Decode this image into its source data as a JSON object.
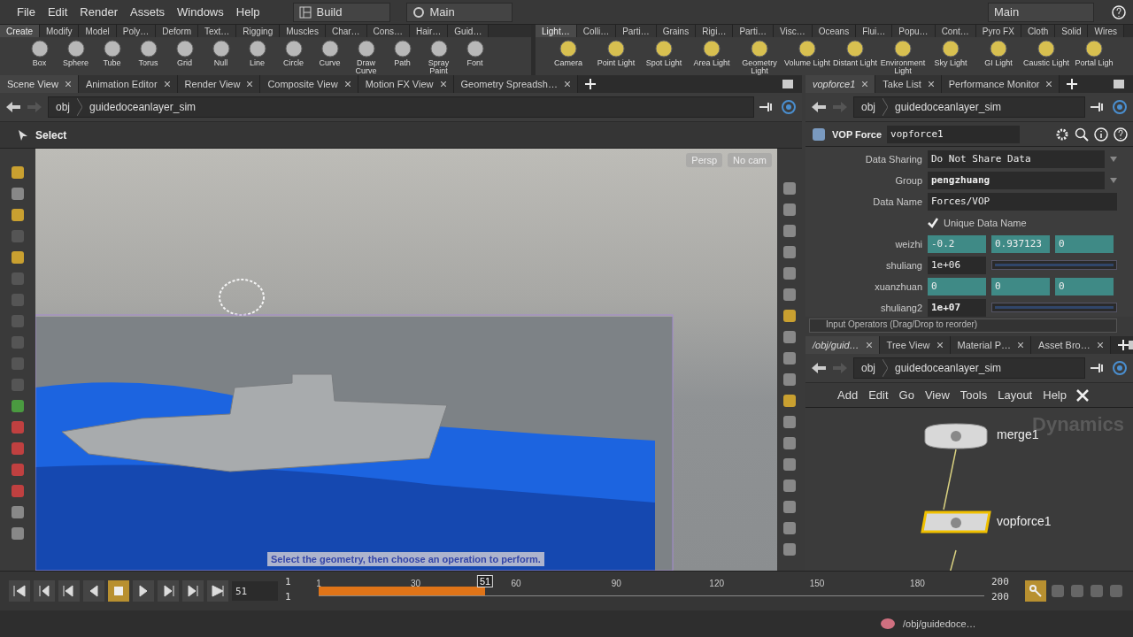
{
  "menubar": {
    "menus": [
      "File",
      "Edit",
      "Render",
      "Assets",
      "Windows",
      "Help"
    ],
    "desktop": "Build",
    "context": "Main",
    "right_context": "Main"
  },
  "shelves": [
    {
      "tabs": [
        {
          "label": "Create",
          "selected": true
        },
        {
          "label": "Modify",
          "selected": false
        },
        {
          "label": "Model",
          "selected": false
        },
        {
          "label": "Poly…",
          "selected": false
        },
        {
          "label": "Deform",
          "selected": false
        },
        {
          "label": "Text…",
          "selected": false
        },
        {
          "label": "Rigging",
          "selected": false
        },
        {
          "label": "Muscles",
          "selected": false
        },
        {
          "label": "Char…",
          "selected": false
        },
        {
          "label": "Cons…",
          "selected": false
        },
        {
          "label": "Hair…",
          "selected": false
        },
        {
          "label": "Guid…",
          "selected": false
        }
      ],
      "tools": [
        "Box",
        "Sphere",
        "Tube",
        "Torus",
        "Grid",
        "Null",
        "Line",
        "Circle",
        "Curve",
        "Draw Curve",
        "Path",
        "Spray Paint",
        "Font"
      ]
    },
    {
      "tabs": [
        {
          "label": "Light…",
          "selected": true
        },
        {
          "label": "Colli…",
          "selected": false
        },
        {
          "label": "Parti…",
          "selected": false
        },
        {
          "label": "Grains",
          "selected": false
        },
        {
          "label": "Rigi…",
          "selected": false
        },
        {
          "label": "Parti…",
          "selected": false
        },
        {
          "label": "Visc…",
          "selected": false
        },
        {
          "label": "Oceans",
          "selected": false
        },
        {
          "label": "Flui…",
          "selected": false
        },
        {
          "label": "Popu…",
          "selected": false
        },
        {
          "label": "Cont…",
          "selected": false
        },
        {
          "label": "Pyro FX",
          "selected": false
        },
        {
          "label": "Cloth",
          "selected": false
        },
        {
          "label": "Solid",
          "selected": false
        },
        {
          "label": "Wires",
          "selected": false
        }
      ],
      "tools": [
        "Camera",
        "Point Light",
        "Spot Light",
        "Area Light",
        "Geometry Light",
        "Volume Light",
        "Distant Light",
        "Environment Light",
        "Sky Light",
        "GI Light",
        "Caustic Light",
        "Portal Ligh"
      ]
    }
  ],
  "scene_pane": {
    "tabs": [
      {
        "label": "Scene View",
        "selected": true
      },
      {
        "label": "Animation Editor",
        "selected": false
      },
      {
        "label": "Render View",
        "selected": false
      },
      {
        "label": "Composite View",
        "selected": false
      },
      {
        "label": "Motion FX View",
        "selected": false
      },
      {
        "label": "Geometry Spreadsh…",
        "selected": false
      }
    ],
    "path": [
      "obj",
      "guidedoceanlayer_sim"
    ],
    "operation": "Select",
    "camera": "Persp",
    "cam_menu": "No cam",
    "prompt": "Select the geometry, then choose an operation to perform."
  },
  "parameter_pane": {
    "tabs": [
      {
        "label": "vopforce1",
        "selected": true
      },
      {
        "label": "Take List",
        "selected": false
      },
      {
        "label": "Performance Monitor",
        "selected": false
      }
    ],
    "path": [
      "obj",
      "guidedoceanlayer_sim"
    ],
    "node_type": "VOP Force",
    "node_name": "vopforce1",
    "params": [
      {
        "kind": "menu",
        "label": "Data Sharing",
        "value": "Do Not Share Data"
      },
      {
        "kind": "menu",
        "label": "Group",
        "value": "pengzhuang"
      },
      {
        "kind": "text",
        "label": "Data Name",
        "value": "Forces/VOP"
      },
      {
        "kind": "toggle",
        "label": "Unique Data Name",
        "checked": true
      },
      {
        "kind": "vector",
        "label": "weizhi",
        "values": [
          "-0.2",
          "0.937123",
          "0"
        ]
      },
      {
        "kind": "slider",
        "label": "shuliang",
        "value": "1e+06",
        "level": 1
      },
      {
        "kind": "vector",
        "label": "xuanzhuan",
        "values": [
          "0",
          "0",
          "0"
        ]
      },
      {
        "kind": "slider",
        "label": "shuliang2",
        "value": "1e+07",
        "level": 1
      }
    ],
    "footer": "Input Operators (Drag/Drop to reorder)"
  },
  "network_pane": {
    "tabs": [
      {
        "label": "/obj/guid…",
        "selected": true
      },
      {
        "label": "Tree View",
        "selected": false
      },
      {
        "label": "Material P…",
        "selected": false
      },
      {
        "label": "Asset Bro…",
        "selected": false
      }
    ],
    "path": [
      "obj",
      "guidedoceanlayer_sim"
    ],
    "menus": [
      "Add",
      "Edit",
      "Go",
      "View",
      "Tools",
      "Layout",
      "Help"
    ],
    "context_label": "Dynamics",
    "nodes": [
      {
        "name": "merge1",
        "kind": "merge",
        "selected": false
      },
      {
        "name": "vopforce1",
        "kind": "force",
        "selected": true
      }
    ]
  },
  "timeline": {
    "frame": "51",
    "start": [
      "1",
      "1"
    ],
    "end": [
      "200",
      "200"
    ],
    "marker": "51",
    "level": 0.25,
    "ticks": [
      {
        "label": "1"
      },
      {
        "label": "30"
      },
      {
        "label": "60"
      },
      {
        "label": "90"
      },
      {
        "label": "120"
      },
      {
        "label": "150"
      },
      {
        "label": "180"
      }
    ]
  },
  "status_bar": {
    "path": "/obj/guidedoce…"
  }
}
